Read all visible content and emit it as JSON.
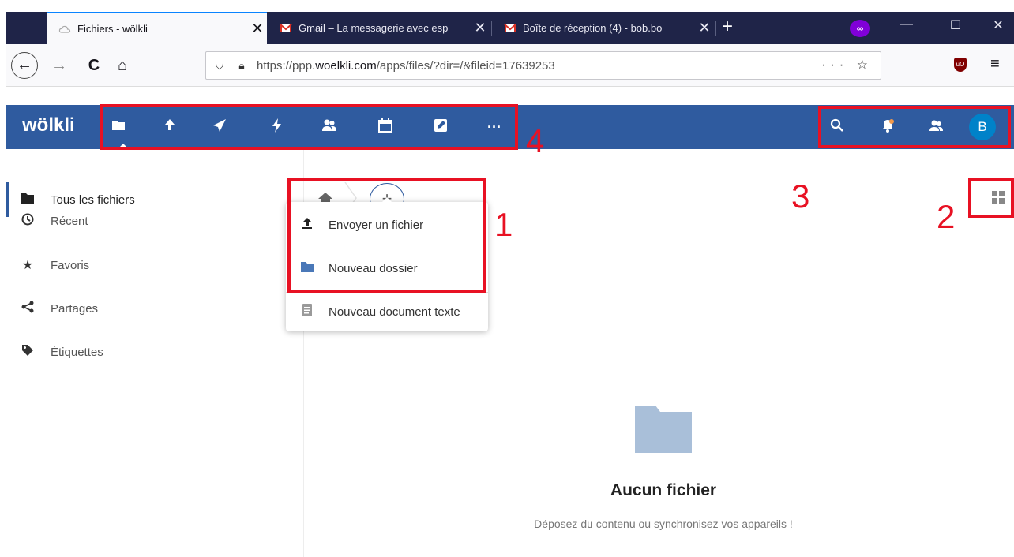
{
  "browser": {
    "tabs": [
      {
        "title": "Fichiers - wölkli",
        "close": "✕",
        "active": true
      },
      {
        "title": "Gmail – La messagerie avec esp",
        "close": "✕",
        "active": false
      },
      {
        "title": "Boîte de réception (4) - bob.bo",
        "close": "✕",
        "active": false
      }
    ],
    "new_tab": "+",
    "window_controls": {
      "minimize": "—",
      "maximize": "☐",
      "close": "✕"
    },
    "nav": {
      "back": "←",
      "forward": "→",
      "reload": "C",
      "home": "⌂"
    },
    "url": {
      "prefix": "https://ppp.",
      "domain": "woelkli.com",
      "path": "/apps/files/?dir=/&fileid=17639253"
    },
    "url_actions": "··· ☆",
    "menu": "≡"
  },
  "app": {
    "logo": "wölkli",
    "header_icons": [
      "folder-icon",
      "upload-icon",
      "send-icon",
      "activity-icon",
      "contacts-icon",
      "calendar-icon",
      "notes-icon",
      "more-icon"
    ],
    "header_right_icons": [
      "search-icon",
      "notifications-icon",
      "contacts-icon"
    ],
    "user_initial": "B",
    "accent": "#2f5b9f"
  },
  "sidebar": {
    "items": [
      {
        "label": "Tous les fichiers",
        "icon": "folder-icon",
        "active": true
      },
      {
        "label": "Récent",
        "icon": "clock-icon",
        "active": false
      },
      {
        "label": "Favoris",
        "icon": "star-icon",
        "active": false
      },
      {
        "label": "Partages",
        "icon": "share-icon",
        "active": false
      },
      {
        "label": "Étiquettes",
        "icon": "tag-icon",
        "active": false
      }
    ]
  },
  "new_menu": {
    "button": "+",
    "items": [
      {
        "label": "Envoyer un fichier",
        "icon": "upload-icon"
      },
      {
        "label": "Nouveau dossier",
        "icon": "folder-icon"
      },
      {
        "label": "Nouveau document texte",
        "icon": "text-document-icon"
      }
    ]
  },
  "empty_state": {
    "title": "Aucun fichier",
    "subtitle": "Déposez du contenu ou synchronisez vos appareils !"
  },
  "annotations": {
    "labels": [
      "1",
      "2",
      "3",
      "4"
    ],
    "color": "#e81123"
  }
}
